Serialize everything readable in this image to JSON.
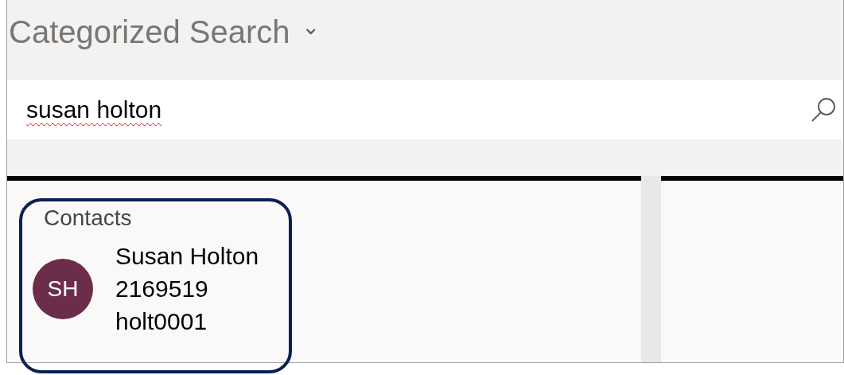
{
  "header": {
    "title": "Categorized Search",
    "caret": "⌄"
  },
  "search": {
    "value": "susan holton",
    "spellcheck_flagged": true
  },
  "results": {
    "category": "Contacts",
    "highlighted": true,
    "items": [
      {
        "initials": "SH",
        "color": "#6b2d4a",
        "name": "Susan Holton",
        "number": "2169519",
        "username": "holt0001"
      }
    ]
  }
}
